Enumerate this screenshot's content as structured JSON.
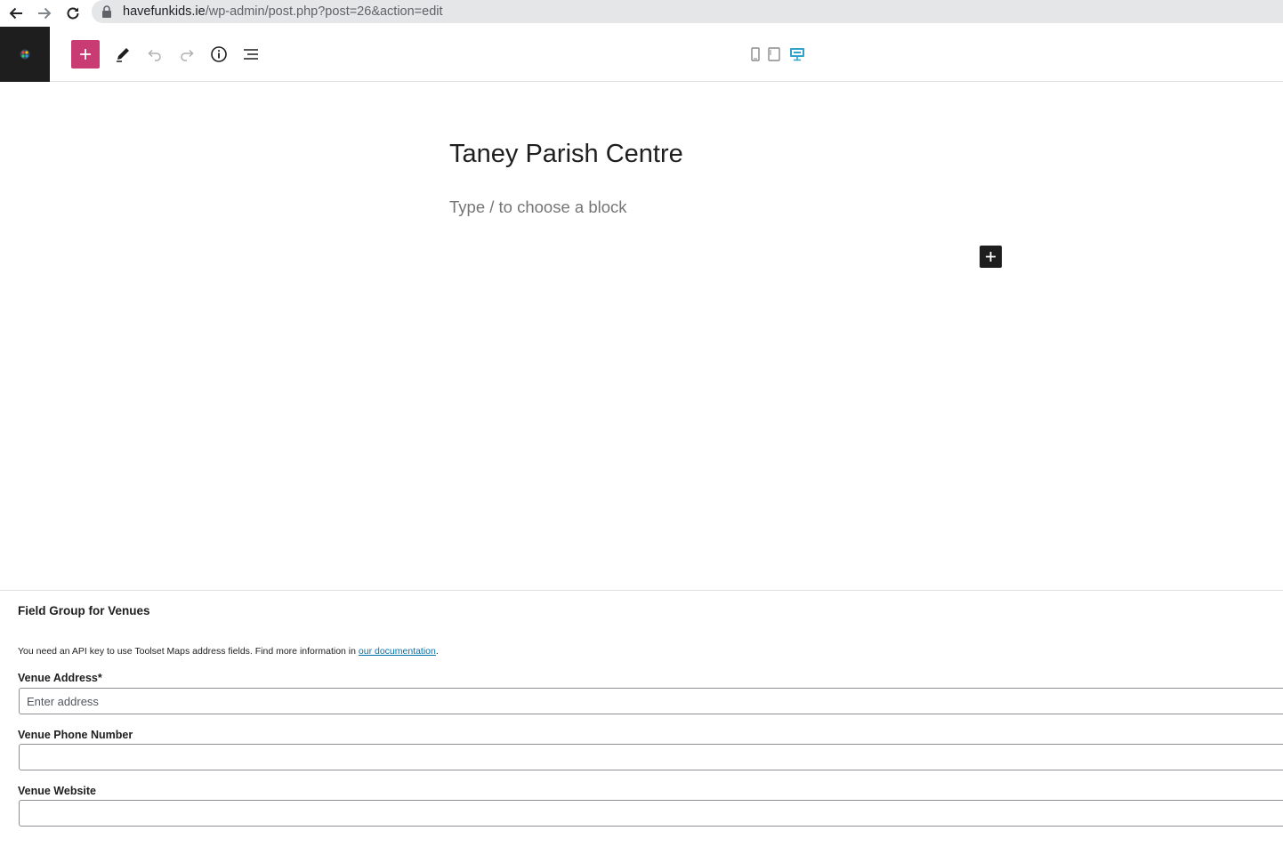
{
  "browser": {
    "url_domain": "havefunkids.ie",
    "url_path": "/wp-admin/post.php?post=26&action=edit"
  },
  "toolbar": {
    "icons": [
      "plus-icon",
      "pencil-icon",
      "undo-icon",
      "redo-icon",
      "info-icon",
      "list-view-icon"
    ],
    "device_preview": [
      "mobile-icon",
      "tablet-icon",
      "desktop-icon"
    ],
    "colors": {
      "inserter": "#c83c73",
      "active_device": "#2ea2cc",
      "logo_bg": "#1e1e1e"
    }
  },
  "editor": {
    "title": "Taney Parish Centre",
    "placeholder": "Type / to choose a block"
  },
  "metabox": {
    "title": "Field Group for Venues",
    "notice_prefix": "You need an API key to use Toolset Maps address fields. Find more information in ",
    "notice_link": "our documentation",
    "notice_suffix": ".",
    "fields": {
      "address": {
        "label": "Venue Address*",
        "placeholder": "Enter address",
        "value": ""
      },
      "phone": {
        "label": "Venue Phone Number",
        "value": ""
      },
      "website": {
        "label": "Venue Website",
        "value": ""
      }
    }
  }
}
